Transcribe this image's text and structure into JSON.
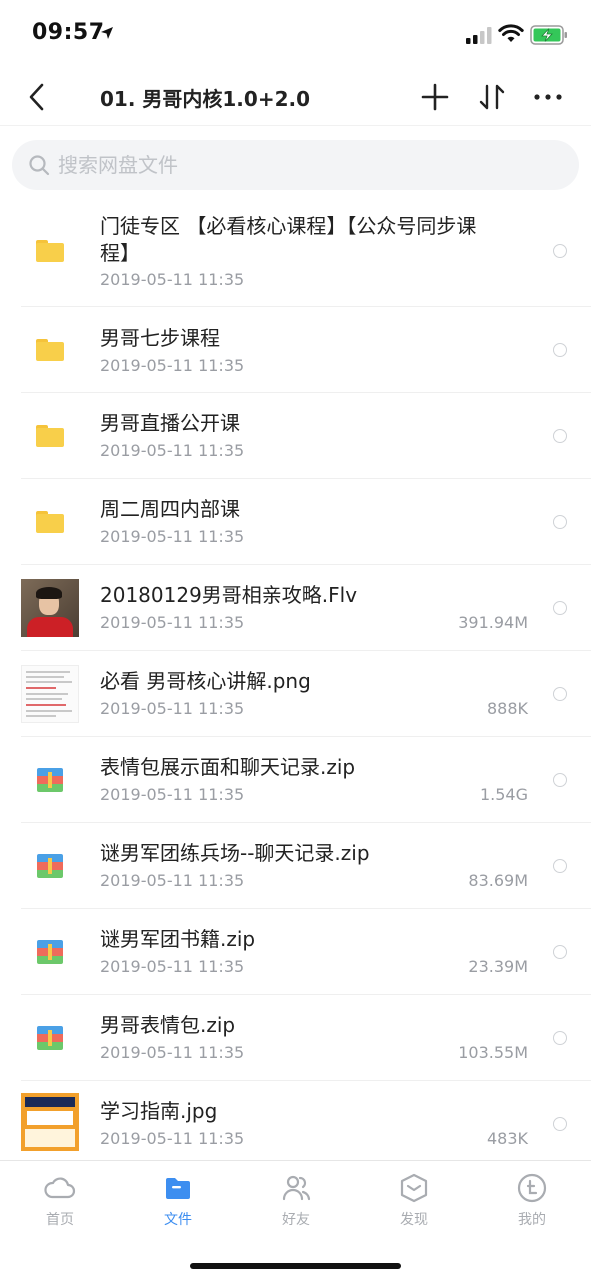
{
  "status_bar": {
    "time": "09:57"
  },
  "header": {
    "title": "01. 男哥内核1.0+2.0"
  },
  "search": {
    "placeholder": "搜索网盘文件"
  },
  "files": [
    {
      "name": "门徒专区 【必看核心课程】【公众号同步课程】",
      "date": "2019-05-11 11:35",
      "size": "",
      "type": "folder"
    },
    {
      "name": "男哥七步课程",
      "date": "2019-05-11 11:35",
      "size": "",
      "type": "folder"
    },
    {
      "name": "男哥直播公开课",
      "date": "2019-05-11 11:35",
      "size": "",
      "type": "folder"
    },
    {
      "name": "周二周四内部课",
      "date": "2019-05-11 11:35",
      "size": "",
      "type": "folder"
    },
    {
      "name": "20180129男哥相亲攻略.Flv",
      "date": "2019-05-11 11:35",
      "size": "391.94M",
      "type": "video"
    },
    {
      "name": "必看 男哥核心讲解.png",
      "date": "2019-05-11 11:35",
      "size": "888K",
      "type": "image-doc"
    },
    {
      "name": "表情包展示面和聊天记录.zip",
      "date": "2019-05-11 11:35",
      "size": "1.54G",
      "type": "zip"
    },
    {
      "name": "谜男军团练兵场--聊天记录.zip",
      "date": "2019-05-11 11:35",
      "size": "83.69M",
      "type": "zip"
    },
    {
      "name": "谜男军团书籍.zip",
      "date": "2019-05-11 11:35",
      "size": "23.39M",
      "type": "zip"
    },
    {
      "name": "男哥表情包.zip",
      "date": "2019-05-11 11:35",
      "size": "103.55M",
      "type": "zip"
    },
    {
      "name": "学习指南.jpg",
      "date": "2019-05-11 11:35",
      "size": "483K",
      "type": "image"
    }
  ],
  "tabs": [
    {
      "label": "首页",
      "icon": "cloud-icon",
      "active": false
    },
    {
      "label": "文件",
      "icon": "folder-icon",
      "active": true
    },
    {
      "label": "好友",
      "icon": "friends-icon",
      "active": false
    },
    {
      "label": "发现",
      "icon": "discover-icon",
      "active": false
    },
    {
      "label": "我的",
      "icon": "profile-icon",
      "active": false
    }
  ],
  "colors": {
    "accent": "#3d8ef0",
    "folder": "#f8cf4a",
    "muted": "#9a9da3"
  }
}
